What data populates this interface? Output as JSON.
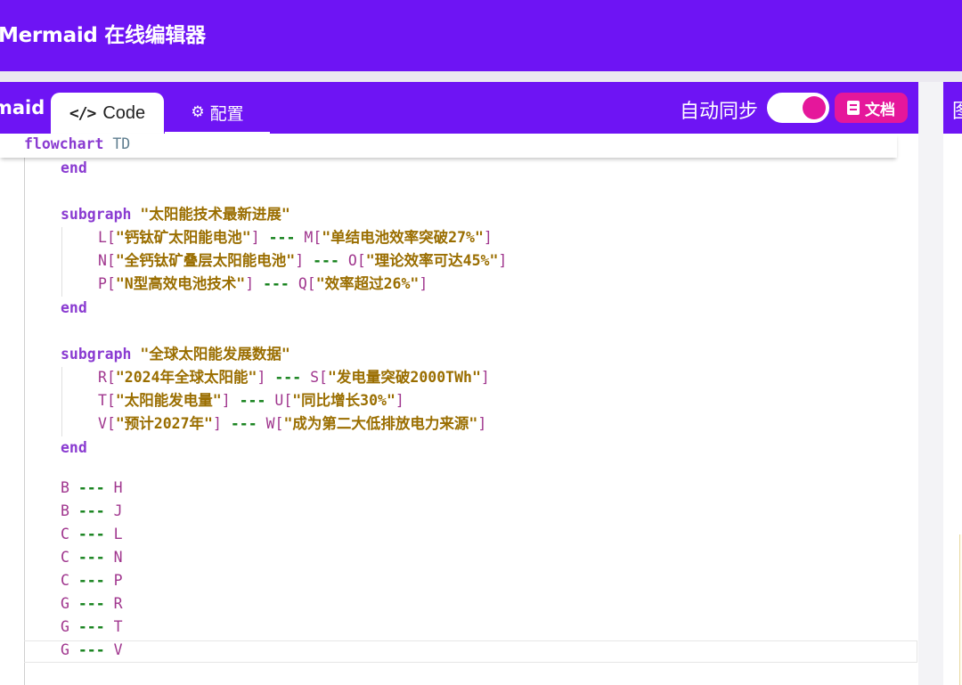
{
  "app": {
    "title": "Mermaid 在线编辑器"
  },
  "editor_header": {
    "brand": "maid",
    "tabs": [
      {
        "icon": "</>",
        "label": "Code",
        "active": true
      },
      {
        "icon": "⚙",
        "label": "配置",
        "active": false
      }
    ],
    "auto_sync_label": "自动同步",
    "auto_sync_on": true,
    "docs_label": "文档"
  },
  "colors": {
    "brand": "#6e14f4",
    "accent": "#e5179b"
  },
  "code": {
    "sticky": {
      "keyword": "flowchart",
      "direction": "TD"
    },
    "end_kw": "end",
    "subgraph_kw": "subgraph",
    "arrow": "---",
    "subgraph_solar": {
      "title": "\"太阳能技术最新进展\"",
      "lines": [
        {
          "a": "L",
          "a_text": "\"钙钛矿太阳能电池\"",
          "b": "M",
          "b_text": "\"单结电池效率突破27%\""
        },
        {
          "a": "N",
          "a_text": "\"全钙钛矿叠层太阳能电池\"",
          "b": "O",
          "b_text": "\"理论效率可达45%\""
        },
        {
          "a": "P",
          "a_text": "\"N型高效电池技术\"",
          "b": "Q",
          "b_text": "\"效率超过26%\""
        }
      ]
    },
    "subgraph_global": {
      "title": "\"全球太阳能发展数据\"",
      "lines": [
        {
          "a": "R",
          "a_text": "\"2024年全球太阳能\"",
          "b": "S",
          "b_text": "\"发电量突破2000TWh\""
        },
        {
          "a": "T",
          "a_text": "\"太阳能发电量\"",
          "b": "U",
          "b_text": "\"同比增长30%\""
        },
        {
          "a": "V",
          "a_text": "\"预计2027年\"",
          "b": "W",
          "b_text": "\"成为第二大低排放电力来源\""
        }
      ]
    },
    "links": [
      {
        "from": "B",
        "to": "H"
      },
      {
        "from": "B",
        "to": "J"
      },
      {
        "from": "C",
        "to": "L"
      },
      {
        "from": "C",
        "to": "N"
      },
      {
        "from": "C",
        "to": "P"
      },
      {
        "from": "G",
        "to": "R"
      },
      {
        "from": "G",
        "to": "T"
      },
      {
        "from": "G",
        "to": "V"
      }
    ]
  },
  "right_panel": {
    "header_glyph": "图"
  }
}
